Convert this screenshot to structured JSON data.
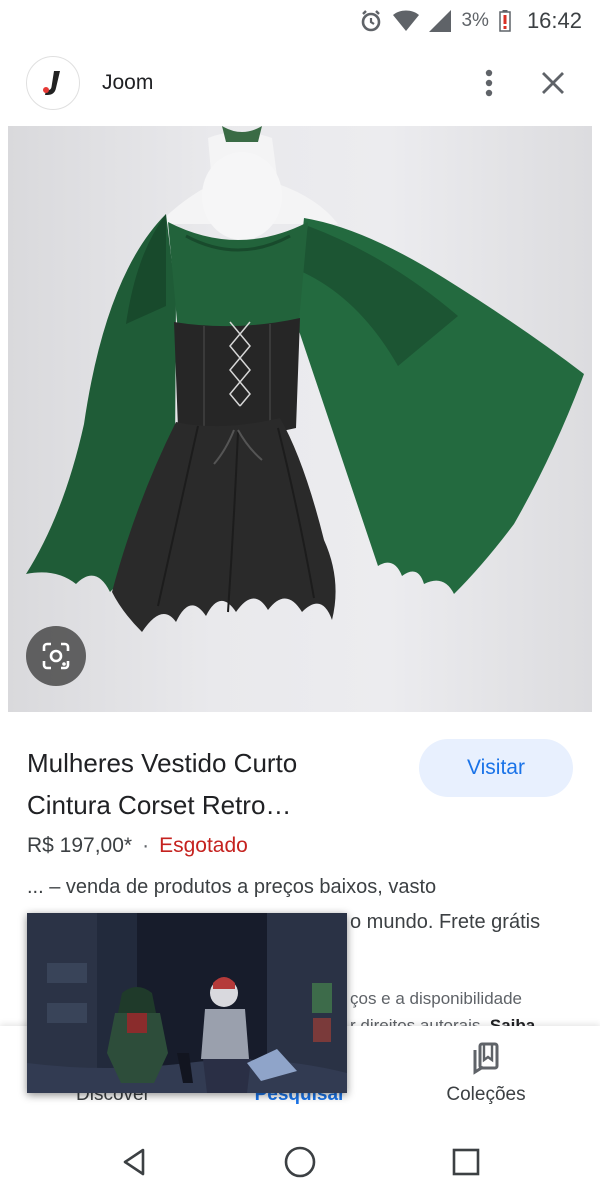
{
  "status_bar": {
    "battery_percent": "3%",
    "time": "16:42",
    "icons": [
      "alarm-icon",
      "wifi-icon",
      "cell-signal-icon",
      "battery-low-icon"
    ]
  },
  "header": {
    "site_name": "Joom",
    "logo_icon": "joom-logo-icon",
    "actions": [
      "more-vert-icon",
      "close-icon"
    ]
  },
  "hero": {
    "lens_icon": "google-lens-icon"
  },
  "result": {
    "title_line1": "Mulheres Vestido Curto",
    "title_line2": "Cintura Corset Retro…",
    "visit_label": "Visitar",
    "price": "R$ 197,00*",
    "separator": "·",
    "stock_status": "Esgotado",
    "snippet_line1": "... – venda de produtos a preços baixos, vasto",
    "snippet_line2": "o mundo. Frete grátis",
    "snippet_line3": "ços e a disponibilidade",
    "snippet_line4_text": "r direitos autorais.",
    "snippet_line4_link": "Saiba"
  },
  "bottom_nav": {
    "items": [
      {
        "label": "Discover",
        "icon": "asterisk-icon"
      },
      {
        "label": "Pesquisar",
        "icon": "search-icon",
        "active": true
      },
      {
        "label": "Coleções",
        "icon": "collections-bookmark-icon"
      }
    ]
  },
  "system_nav": {
    "buttons": [
      "back-icon",
      "home-icon",
      "recents-icon"
    ]
  },
  "colors": {
    "accent": "#1a73e8",
    "visit_bg": "#e8f0fe",
    "out_of_stock": "#c5221f",
    "dress_green": "#1e5a35",
    "corset_black": "#222222"
  }
}
